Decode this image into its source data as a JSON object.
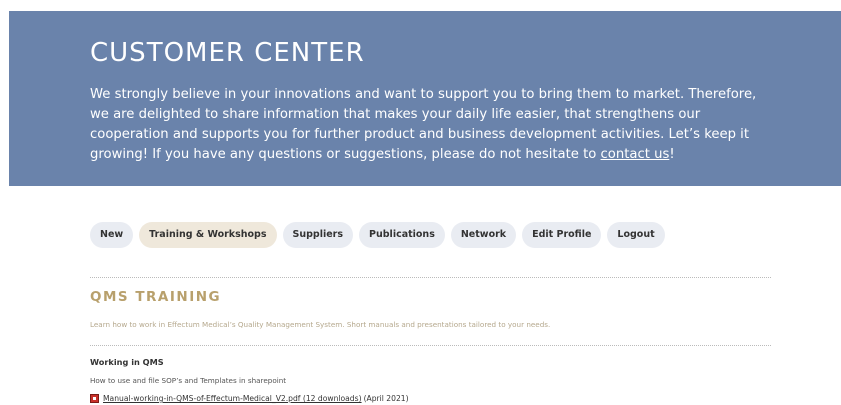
{
  "hero": {
    "title": "CUSTOMER CENTER",
    "text_before_link": "We strongly believe in your innovations and want to support you to bring them to market. Therefore, we are delighted to share information that makes your daily life easier, that strengthens our cooperation and supports you for further product and business development activities. Let’s keep it growing! If you have any questions or suggestions, please do not hesitate to ",
    "link_label": "contact us",
    "text_after_link": "!"
  },
  "nav": {
    "items": [
      {
        "label": "New"
      },
      {
        "label": "Training & Workshops",
        "active": true
      },
      {
        "label": "Suppliers"
      },
      {
        "label": "Publications"
      },
      {
        "label": "Network"
      },
      {
        "label": "Edit Profile"
      },
      {
        "label": "Logout"
      }
    ]
  },
  "section": {
    "title": "QMS TRAINING",
    "description": "Learn how to work in Effectum Medical’s Quality Management System. Short manuals and presentations tailored to your needs."
  },
  "item": {
    "title": "Working in QMS",
    "description": "How to use and file SOP’s and Templates in sharepoint",
    "file_icon": "pdf-icon",
    "file_link": "Manual-working-in-QMS-of-Effectum-Medical_V2.pdf (12 downloads)",
    "file_date": "(April 2021)"
  },
  "colors": {
    "hero_bg": "#6a83ab",
    "accent_gold": "#b8a06c",
    "pill_bg": "#e9ecf2",
    "pill_active_bg": "#efe8db"
  }
}
